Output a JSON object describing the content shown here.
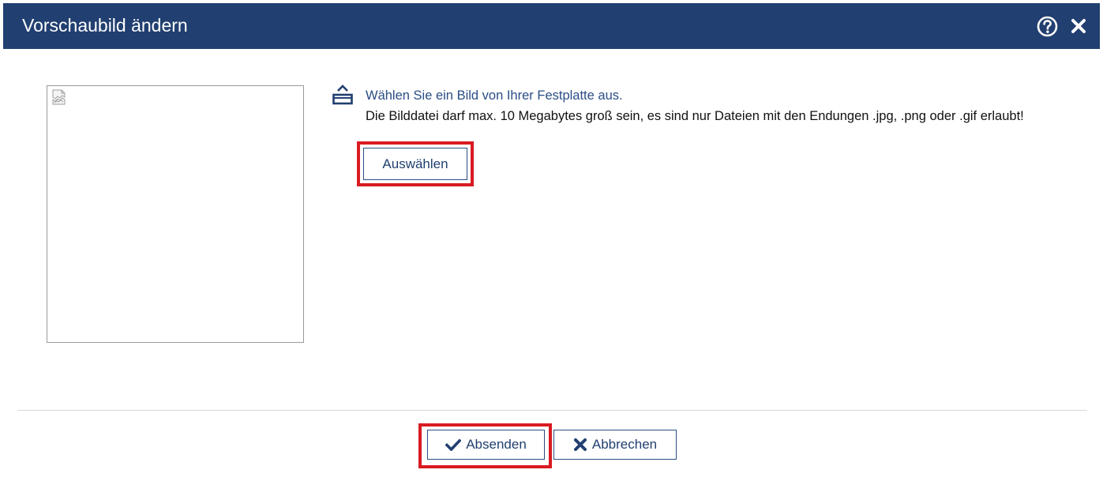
{
  "dialog": {
    "title": "Vorschaubild ändern",
    "help_icon": "help-circle-icon",
    "close_icon": "close-icon"
  },
  "preview": {
    "placeholder_icon": "broken-image-icon"
  },
  "upload": {
    "icon": "upload-icon",
    "hint": "Wählen Sie ein Bild von Ihrer Festplatte aus.",
    "restrictions": "Die Bilddatei darf max. 10 Megabytes groß sein, es sind nur Dateien mit den Endungen .jpg, .png oder .gif erlaubt!",
    "choose_label": "Auswählen"
  },
  "footer": {
    "submit_label": "Absenden",
    "submit_icon": "checkmark-icon",
    "cancel_label": "Abbrechen",
    "cancel_icon": "close-x-icon"
  },
  "colors": {
    "title_bar": "#213f70",
    "link_text": "#2a4d85",
    "highlight": "#d91b22"
  }
}
